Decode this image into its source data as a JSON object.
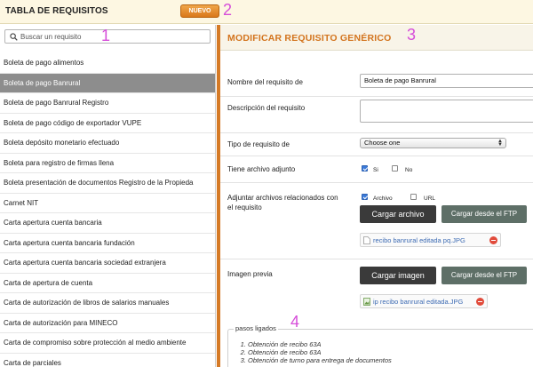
{
  "header": {
    "title": "TABLA DE REQUISITOS",
    "new_button": "NUEVO"
  },
  "annotations": [
    "1",
    "2",
    "3",
    "4"
  ],
  "search": {
    "placeholder": "Buscar un requisito"
  },
  "list": {
    "items": [
      "Boleta de pago alimentos",
      "Boleta de pago Banrural",
      "Boleta de pago Banrural Registro",
      "Boleta de pago código de exportador VUPE",
      "Boleta depósito monetario efectuado",
      "Boleta para registro de firmas llena",
      "Boleta presentación de documentos Registro de la Propieda",
      "Carnet NIT",
      "Carta apertura cuenta bancaria",
      "Carta apertura cuenta bancaria fundación",
      "Carta apertura cuenta bancaria sociedad extranjera",
      "Carta de apertura de cuenta",
      "Carta de autorización de libros de salarios manuales",
      "Carta de autorización para MINECO",
      "Carta de compromiso sobre protección al medio ambiente",
      "Carta de parciales"
    ],
    "selected_index": 1
  },
  "form": {
    "heading": "MODIFICAR REQUISITO GENÉRICO",
    "name_label": "Nombre del requisito de",
    "name_value": "Boleta de pago Banrural",
    "description_label": "Descripción del requisito",
    "type_label": "Tipo de requisito de",
    "type_value": "Choose one",
    "has_file_label": "Tiene archivo adjunto",
    "has_file_yes": "Si",
    "has_file_no": "No",
    "attach_label_1": "Adjuntar archivos relacionados con",
    "attach_label_2": "el requisito",
    "attach_opt_file": "Archivo",
    "attach_opt_url": "URL",
    "upload_file_button": "Cargar archivo",
    "ftp_button_1": "Cargar desde el FTP",
    "attached_file": "recibo banrural editada pq.JPG",
    "preview_label": "Imagen previa",
    "upload_image_button": "Cargar imagen",
    "ftp_button_2": "Cargar desde el FTP",
    "preview_file": "ip recibo banrural editada.JPG"
  },
  "pasos": {
    "legend": "pasos ligados",
    "items": [
      "Obtención de recibo 63A",
      "Obtención de recibo 63A",
      "Obtención de turno para entrega de documentos"
    ]
  },
  "colors": {
    "accent_orange": "#d3741e",
    "annotation_magenta": "#d64dd9",
    "selected_row": "#8d8d8d",
    "dark_button": "#3a3a3a",
    "green_button": "#5e6f67"
  }
}
